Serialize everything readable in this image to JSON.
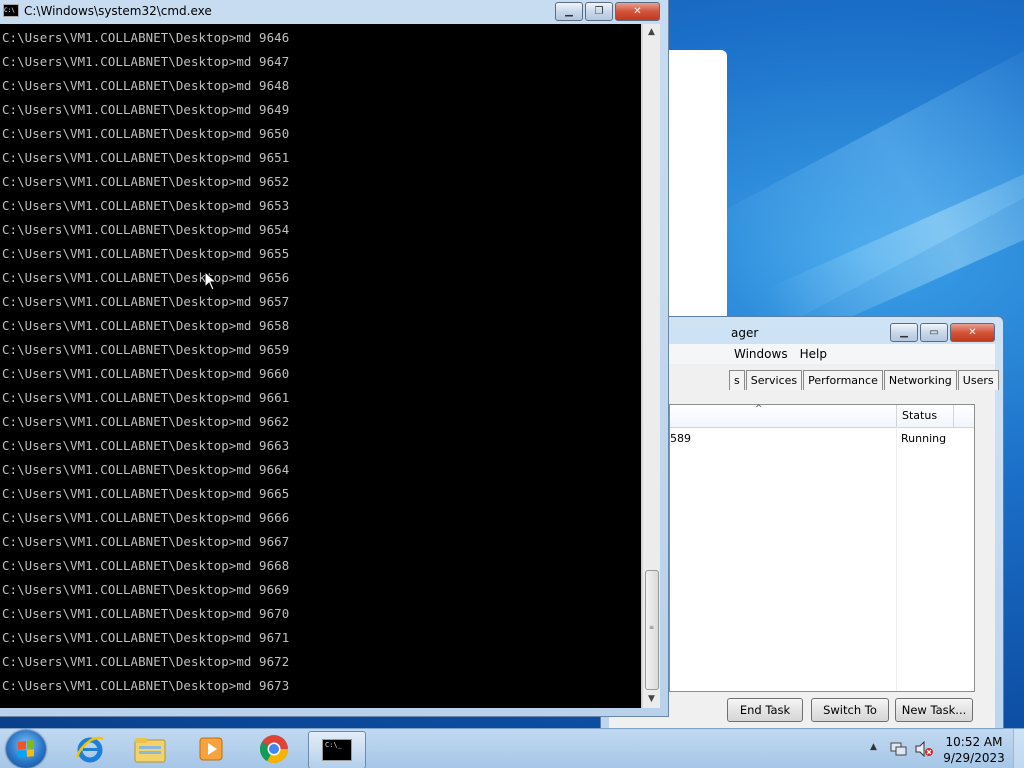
{
  "cmd_window": {
    "title": "C:\\Windows\\system32\\cmd.exe",
    "icon_text": "C:\\",
    "prompt": "C:\\Users\\VM1.COLLABNET\\Desktop>",
    "lines": [
      "C:\\Users\\VM1.COLLABNET\\Desktop>md 9646",
      "C:\\Users\\VM1.COLLABNET\\Desktop>md 9647",
      "C:\\Users\\VM1.COLLABNET\\Desktop>md 9648",
      "C:\\Users\\VM1.COLLABNET\\Desktop>md 9649",
      "C:\\Users\\VM1.COLLABNET\\Desktop>md 9650",
      "C:\\Users\\VM1.COLLABNET\\Desktop>md 9651",
      "C:\\Users\\VM1.COLLABNET\\Desktop>md 9652",
      "C:\\Users\\VM1.COLLABNET\\Desktop>md 9653",
      "C:\\Users\\VM1.COLLABNET\\Desktop>md 9654",
      "C:\\Users\\VM1.COLLABNET\\Desktop>md 9655",
      "C:\\Users\\VM1.COLLABNET\\Desktop>md 9656",
      "C:\\Users\\VM1.COLLABNET\\Desktop>md 9657",
      "C:\\Users\\VM1.COLLABNET\\Desktop>md 9658",
      "C:\\Users\\VM1.COLLABNET\\Desktop>md 9659",
      "C:\\Users\\VM1.COLLABNET\\Desktop>md 9660",
      "C:\\Users\\VM1.COLLABNET\\Desktop>md 9661",
      "C:\\Users\\VM1.COLLABNET\\Desktop>md 9662",
      "C:\\Users\\VM1.COLLABNET\\Desktop>md 9663",
      "C:\\Users\\VM1.COLLABNET\\Desktop>md 9664",
      "C:\\Users\\VM1.COLLABNET\\Desktop>md 9665",
      "C:\\Users\\VM1.COLLABNET\\Desktop>md 9666",
      "C:\\Users\\VM1.COLLABNET\\Desktop>md 9667",
      "C:\\Users\\VM1.COLLABNET\\Desktop>md 9668",
      "C:\\Users\\VM1.COLLABNET\\Desktop>md 9669",
      "C:\\Users\\VM1.COLLABNET\\Desktop>md 9670",
      "C:\\Users\\VM1.COLLABNET\\Desktop>md 9671",
      "C:\\Users\\VM1.COLLABNET\\Desktop>md 9672",
      "C:\\Users\\VM1.COLLABNET\\Desktop>md 9673"
    ],
    "text_color": "#c0c0c0",
    "background": "#000000"
  },
  "task_manager": {
    "title_fragment": "ager",
    "menu": [
      "Windows",
      "Help"
    ],
    "tabs": [
      "s",
      "Services",
      "Performance",
      "Networking",
      "Users"
    ],
    "columns": {
      "status": "Status",
      "sort_arrow": "^"
    },
    "rows": [
      {
        "name_fragment": "589",
        "status": "Running"
      }
    ],
    "buttons": {
      "end_task": "End Task",
      "switch_to": "Switch To",
      "new_task": "New Task..."
    }
  },
  "taskbar": {
    "items": [
      "start-button",
      "internet-explorer-icon",
      "windows-explorer-icon",
      "media-player-icon",
      "chrome-icon",
      "cmd-icon"
    ],
    "active_item": "cmd-icon",
    "cmd_icon_text": "C:\\_",
    "clock": {
      "time": "10:52 AM",
      "date": "9/29/2023"
    }
  },
  "colors": {
    "desktop": "#1b6fc8",
    "close_button": "#d2543a"
  }
}
